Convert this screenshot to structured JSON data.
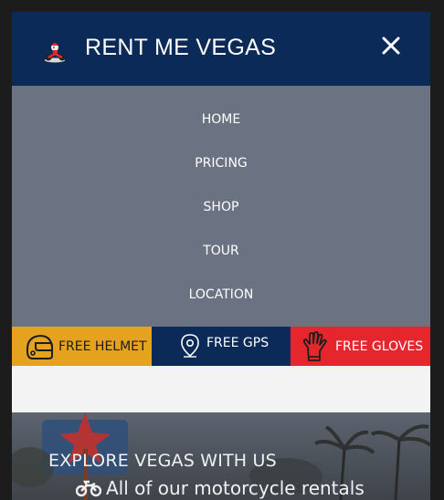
{
  "header": {
    "brand": "RENT ME VEGAS",
    "logo_icon": "rider-mascot-icon",
    "close_icon": "close-icon"
  },
  "menu": {
    "items": [
      {
        "label": "HOME"
      },
      {
        "label": "PRICING"
      },
      {
        "label": "SHOP"
      },
      {
        "label": "TOUR"
      },
      {
        "label": "LOCATION"
      }
    ]
  },
  "features": [
    {
      "label": "FREE HELMET",
      "icon": "helmet-icon",
      "color": "#e4a21f"
    },
    {
      "label": "FREE GPS",
      "icon": "map-pin-icon",
      "color": "#0b2a57"
    },
    {
      "label": "FREE GLOVES",
      "icon": "glove-icon",
      "color": "#e5262c"
    }
  ],
  "hero": {
    "title": "EXPLORE VEGAS WITH US",
    "subtitle": "All of our motorcycle rentals",
    "subtitle_icon": "motorcycle-icon"
  },
  "colors": {
    "navy": "#0b2a57",
    "menu_bg": "#6b7281",
    "helmet_bg": "#e4a21f",
    "gloves_bg": "#e5262c"
  }
}
